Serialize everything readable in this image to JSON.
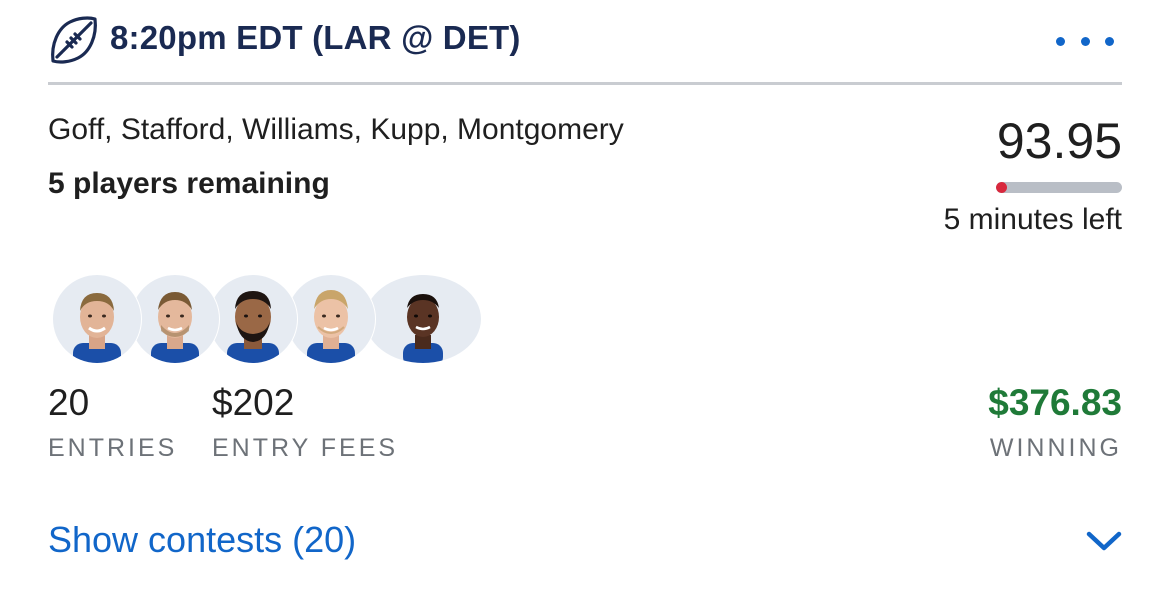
{
  "header": {
    "title": "8:20pm EDT (LAR @ DET)",
    "sport_icon": "football-icon",
    "more_icon": "more-horizontal-icon"
  },
  "lineup": {
    "players": "Goff, Stafford, Williams, Kupp, Montgomery",
    "remaining": "5 players remaining",
    "score": "93.95",
    "progress_fraction": 0.04,
    "time_left": "5 minutes left",
    "avatars": [
      "player-avatar-goff",
      "player-avatar-stafford",
      "player-avatar-williams",
      "player-avatar-kupp",
      "player-avatar-montgomery"
    ]
  },
  "stats": {
    "entries_value": "20",
    "entries_label": "ENTRIES",
    "fees_value": "$202",
    "fees_label": "ENTRY FEES",
    "winning_value": "$376.83",
    "winning_label": "WINNING"
  },
  "footer": {
    "show_contests": "Show contests (20)",
    "expand_icon": "chevron-down-icon"
  },
  "colors": {
    "title": "#1a2a52",
    "accent": "#1166c9",
    "winning": "#1f7a38",
    "progress": "#d8283d",
    "track": "#b9bec6"
  }
}
